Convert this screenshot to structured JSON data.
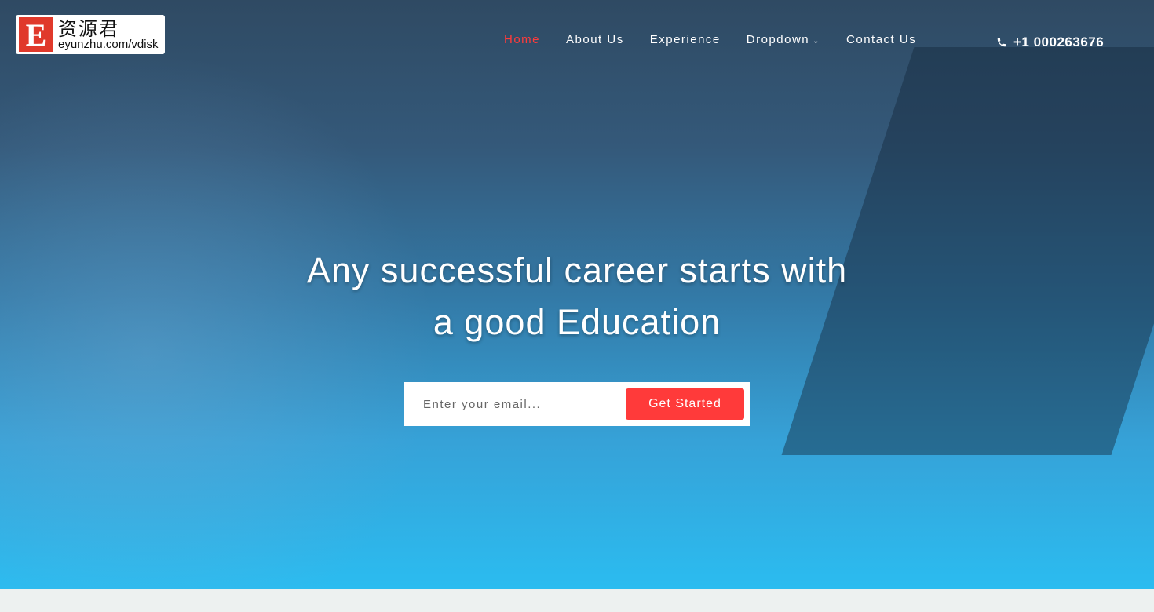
{
  "logo": {
    "letter": "E",
    "chinese": "资源君",
    "url": "eyunzhu.com/vdisk"
  },
  "nav": {
    "items": [
      {
        "label": "Home",
        "active": true
      },
      {
        "label": "About Us"
      },
      {
        "label": "Experience"
      },
      {
        "label": "Dropdown",
        "has_dropdown": true
      },
      {
        "label": "Contact Us"
      }
    ]
  },
  "phone": {
    "icon": "phone-icon",
    "number": "+1 000263676"
  },
  "hero": {
    "title": "Any successful career starts with a good Education"
  },
  "signup": {
    "placeholder": "Enter your email...",
    "button": "Get Started"
  },
  "colors": {
    "accent": "#ff3a3a"
  }
}
